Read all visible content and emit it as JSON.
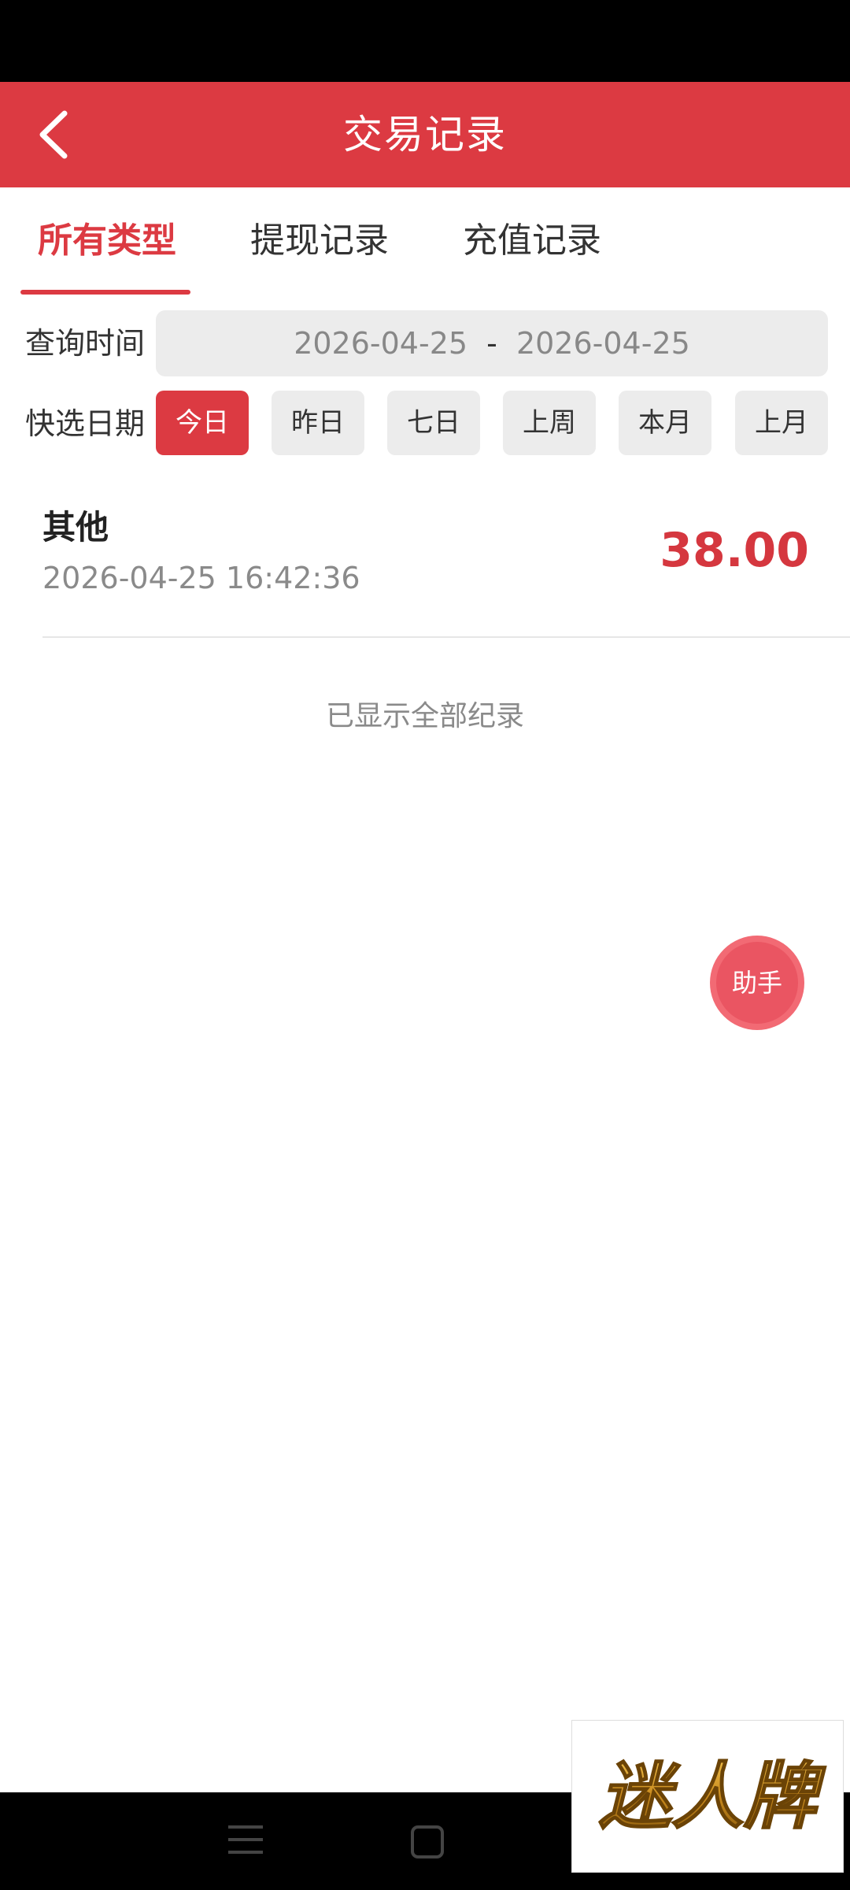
{
  "header": {
    "title": "交易记录"
  },
  "tabs": [
    {
      "label": "所有类型",
      "active": true
    },
    {
      "label": "提现记录",
      "active": false
    },
    {
      "label": "充值记录",
      "active": false
    }
  ],
  "query": {
    "label": "查询时间",
    "start_date": "2026-04-25",
    "separator": "-",
    "end_date": "2026-04-25"
  },
  "quick_select": {
    "label": "快选日期",
    "options": [
      "今日",
      "昨日",
      "七日",
      "上周",
      "本月",
      "上月"
    ],
    "selected": "今日"
  },
  "records": [
    {
      "type": "其他",
      "time": "2026-04-25 16:42:36",
      "amount": "38.00"
    }
  ],
  "end_text": "已显示全部纪录",
  "assistant_label": "助手",
  "brand_text": "迷人牌",
  "colors": {
    "accent": "#dc3a42",
    "amount": "#d5373f",
    "brand_gold": "#c8891d"
  },
  "icons": {
    "back": "chevron-left-icon",
    "nav_menu": "menu-icon",
    "nav_home": "home-icon"
  }
}
